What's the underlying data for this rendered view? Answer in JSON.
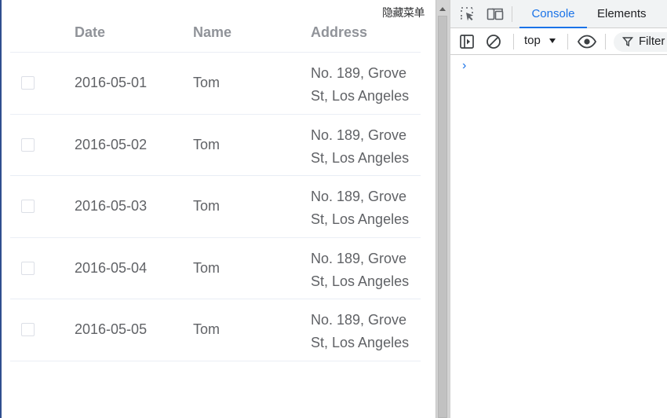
{
  "page": {
    "hidden_menu_label": "隐藏菜单",
    "table": {
      "columns": [
        "Date",
        "Name",
        "Address"
      ],
      "rows": [
        {
          "date": "2016-05-01",
          "name": "Tom",
          "address": "No. 189, Grove St, Los Angeles"
        },
        {
          "date": "2016-05-02",
          "name": "Tom",
          "address": "No. 189, Grove St, Los Angeles"
        },
        {
          "date": "2016-05-03",
          "name": "Tom",
          "address": "No. 189, Grove St, Los Angeles"
        },
        {
          "date": "2016-05-04",
          "name": "Tom",
          "address": "No. 189, Grove St, Los Angeles"
        },
        {
          "date": "2016-05-05",
          "name": "Tom",
          "address": "No. 189, Grove St, Los Angeles"
        }
      ]
    }
  },
  "devtools": {
    "tabs": [
      "Console",
      "Elements"
    ],
    "active_tab": "Console",
    "context_selector": "top",
    "filter_label": "Filter",
    "prompt_symbol": "›",
    "accent_color": "#1a73e8"
  }
}
